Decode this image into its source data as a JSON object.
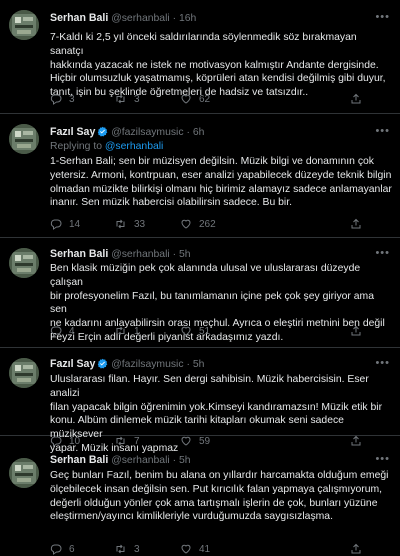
{
  "tweets": [
    {
      "name": "Serhan Bali",
      "handle": "@serhanbali",
      "time": "16h",
      "verified": false,
      "reply_to": null,
      "lines": [
        "7-Kaldı ki 2,5 yıl önceki saldırılarında söylenmedik söz bırakmayan sanatçı",
        "hakkında yazacak ne istek ne motivasyon kalmıştır Andante dergisinde.",
        "Hiçbir olumsuzluk yaşatmamış, köprüleri atan kendisi değilmiş gibi duyur,",
        "tanıt, işin bu şeklinde öğretmeleri de hadsiz ve tatsızdır.."
      ],
      "replies": "3",
      "retweets": "3",
      "likes": "62"
    },
    {
      "name": "Fazıl Say",
      "handle": "@fazilsaymusic",
      "time": "6h",
      "verified": true,
      "reply_to": {
        "prefix": "Replying to ",
        "mention": "@serhanbali"
      },
      "lines": [
        "1-Serhan Bali; sen bir müzisyen değilsin. Müzik bilgi ve donamının çok",
        "yetersiz. Armoni, kontrpuan, eser analizi yapabilecek düzeyde teknik bilgin",
        "olmadan müzikte bilirkişi olmanı hiç birimiz alamayız  sadece anlamayanlar",
        "inanır. Sen müzik habercisi olabilirsin sadece. Bu bir."
      ],
      "replies": "14",
      "retweets": "33",
      "likes": "262"
    },
    {
      "name": "Serhan Bali",
      "handle": "@serhanbali",
      "time": "5h",
      "verified": false,
      "reply_to": null,
      "lines": [
        "Ben klasik müziğin pek çok alanında ulusal ve uluslararası düzeyde çalışan",
        "bir profesyonelim Fazıl, bu tanımlamanın içine pek çok şey giriyor ama sen",
        "ne kadarını anlayabilirsin orası meçhul. Ayrıca o eleştiri metnini ben değil",
        "Feyzi Erçin adlı değerli piyanist arkadaşımız yazdı."
      ],
      "replies": "4",
      "retweets": "1",
      "likes": "51"
    },
    {
      "name": "Fazıl Say",
      "handle": "@fazilsaymusic",
      "time": "5h",
      "verified": true,
      "reply_to": null,
      "lines": [
        "Uluslararası filan. Hayır. Sen dergi sahibisin. Müzik habercisisin. Eser analizi",
        "filan yapacak bilgin öğrenimin yok.Kimseyi kandıramazsın! Müzik etik bir",
        "konu. Albüm dinlemek müzik tarihi kitapları okumak seni sadece müziksever",
        "yapar. Müzik insanı yapmaz"
      ],
      "replies": "10",
      "retweets": "7",
      "likes": "59"
    },
    {
      "name": "Serhan Bali",
      "handle": "@serhanbali",
      "time": "5h",
      "verified": false,
      "reply_to": null,
      "lines": [
        "Geç bunları Fazıl, benim bu alana on yıllardır harcamakta olduğum emeği",
        "ölçebilecek insan değilsin sen. Put kırıcılık falan yapmaya çalışmıyorum,",
        "değerli olduğun yönler çok ama tartışmalı işlerin de çok, bunları yüzüne",
        "eleştirmen/yayıncı kimlikleriyle vurduğumuzda saygısızlaşma."
      ],
      "replies": "6",
      "retweets": "3",
      "likes": "41"
    }
  ],
  "colors": {
    "background": "#000000",
    "text": "#e7e9ea",
    "secondary": "#71767b",
    "link": "#1d9bf0",
    "verified": "#1d9bf0",
    "divider": "#2f3336"
  },
  "icons": {
    "reply": "speech-bubble-icon",
    "retweet": "retweet-icon",
    "like": "heart-icon",
    "share": "share-icon",
    "more": "more-dots-icon",
    "verified": "verified-badge-icon"
  }
}
